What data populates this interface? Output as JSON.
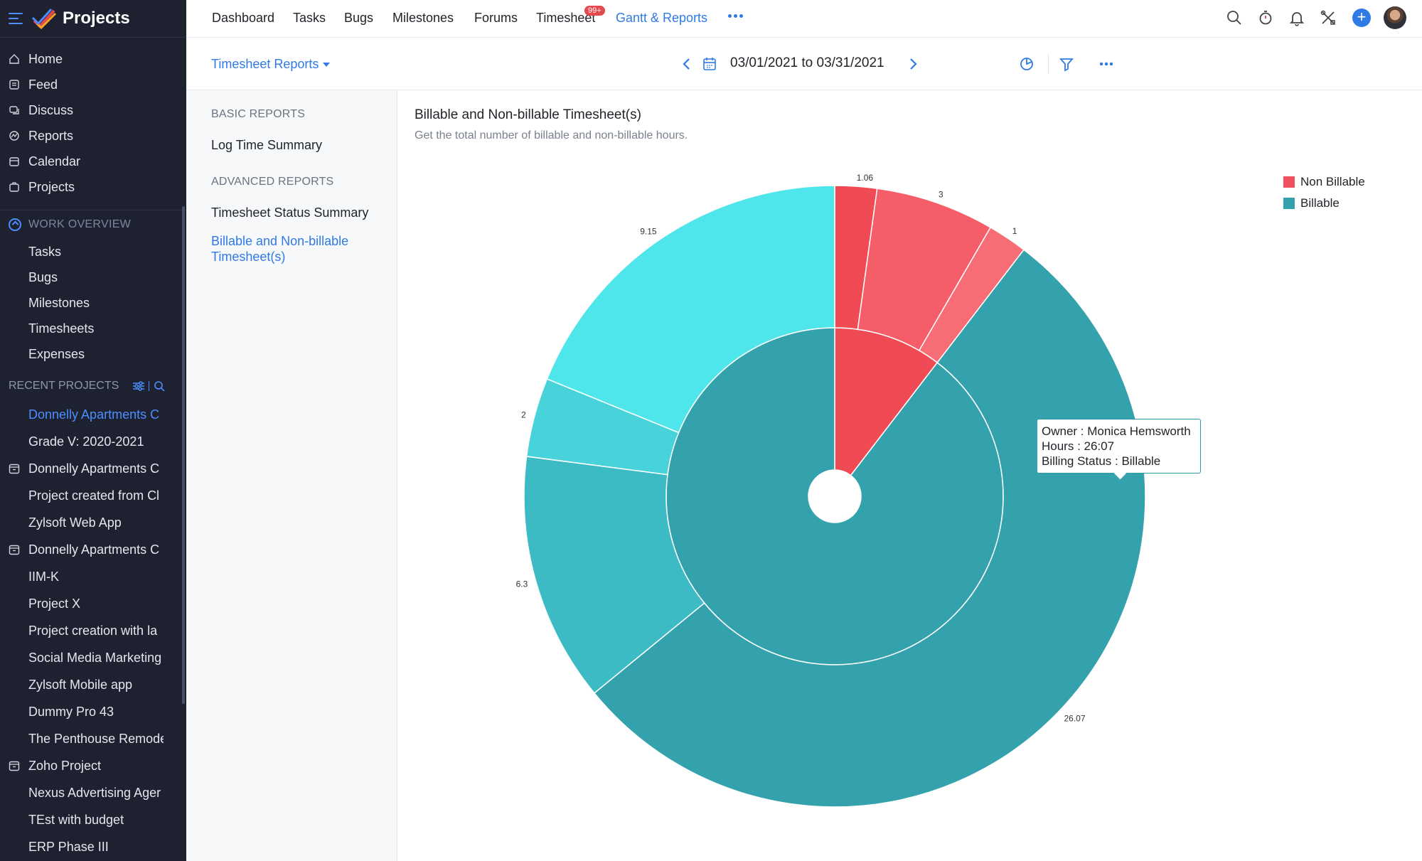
{
  "app": {
    "title": "Projects"
  },
  "sidebar": {
    "main_items": [
      {
        "label": "Home",
        "icon": "home-icon"
      },
      {
        "label": "Feed",
        "icon": "feed-icon"
      },
      {
        "label": "Discuss",
        "icon": "discuss-icon"
      },
      {
        "label": "Reports",
        "icon": "reports-icon"
      },
      {
        "label": "Calendar",
        "icon": "calendar-icon"
      },
      {
        "label": "Projects",
        "icon": "projects-icon"
      }
    ],
    "work_overview": {
      "label": "WORK OVERVIEW",
      "items": [
        "Tasks",
        "Bugs",
        "Milestones",
        "Timesheets",
        "Expenses"
      ]
    },
    "recent_projects": {
      "label": "RECENT PROJECTS",
      "items": [
        "Donnelly Apartments C",
        "Grade V: 2020-2021",
        "Donnelly Apartments C",
        "Project created from Cl",
        "Zylsoft Web App",
        "Donnelly Apartments C",
        "IIM-K",
        "Project X",
        "Project creation with la",
        "Social Media Marketing",
        "Zylsoft Mobile app",
        "Dummy Pro 43",
        "The Penthouse Remode",
        "Zoho Project",
        "Nexus Advertising Ager",
        "TEst with budget",
        "ERP Phase III"
      ]
    }
  },
  "topbar": {
    "tabs": [
      "Dashboard",
      "Tasks",
      "Bugs",
      "Milestones",
      "Forums",
      "Timesheet",
      "Gantt & Reports"
    ],
    "active_tab": "Gantt & Reports",
    "timesheet_badge": "99+"
  },
  "subhead": {
    "report_selector": "Timesheet Reports",
    "date_range": "03/01/2021 to 03/31/2021"
  },
  "report_nav": {
    "basic_label": "BASIC REPORTS",
    "basic_items": [
      "Log Time Summary"
    ],
    "advanced_label": "ADVANCED REPORTS",
    "advanced_items": [
      "Timesheet Status Summary",
      "Billable and Non-billable Timesheet(s)"
    ]
  },
  "tooltip": {
    "line1": "Owner : Monica Hemsworth",
    "line2": "Hours : 26:07",
    "line3": "Billing Status : Billable"
  },
  "colors": {
    "accent": "#2f7ae5",
    "sidebar_bg": "#1e2230",
    "non_billable": "#f0505a",
    "billable": "#34a2ad"
  },
  "chart_data": {
    "type": "pie",
    "title": "Billable and Non-billable Timesheet(s)",
    "subtitle": "Get the total number of billable and non-billable hours.",
    "legend": [
      "Non Billable",
      "Billable"
    ],
    "legend_position": "top-right",
    "inner_ring": [
      {
        "name": "Non Billable",
        "value": 5.06,
        "color": "#f04a54"
      },
      {
        "name": "Billable",
        "value": 43.52,
        "color": "#34a2ad"
      }
    ],
    "outer_ring": [
      {
        "label": "1.06",
        "value": 1.06,
        "group": "Non Billable",
        "color": "#f04a54"
      },
      {
        "label": "3",
        "value": 3,
        "group": "Non Billable",
        "color": "#f55d68"
      },
      {
        "label": "1",
        "value": 1,
        "group": "Non Billable",
        "color": "#f66d75"
      },
      {
        "label": "26.07",
        "value": 26.07,
        "group": "Billable",
        "color": "#34a2ad"
      },
      {
        "label": "6.3",
        "value": 6.3,
        "group": "Billable",
        "color": "#3dbbc5"
      },
      {
        "label": "2",
        "value": 2,
        "group": "Billable",
        "color": "#48d2da"
      },
      {
        "label": "9.15",
        "value": 9.15,
        "group": "Billable",
        "color": "#4ee6ea"
      }
    ]
  }
}
